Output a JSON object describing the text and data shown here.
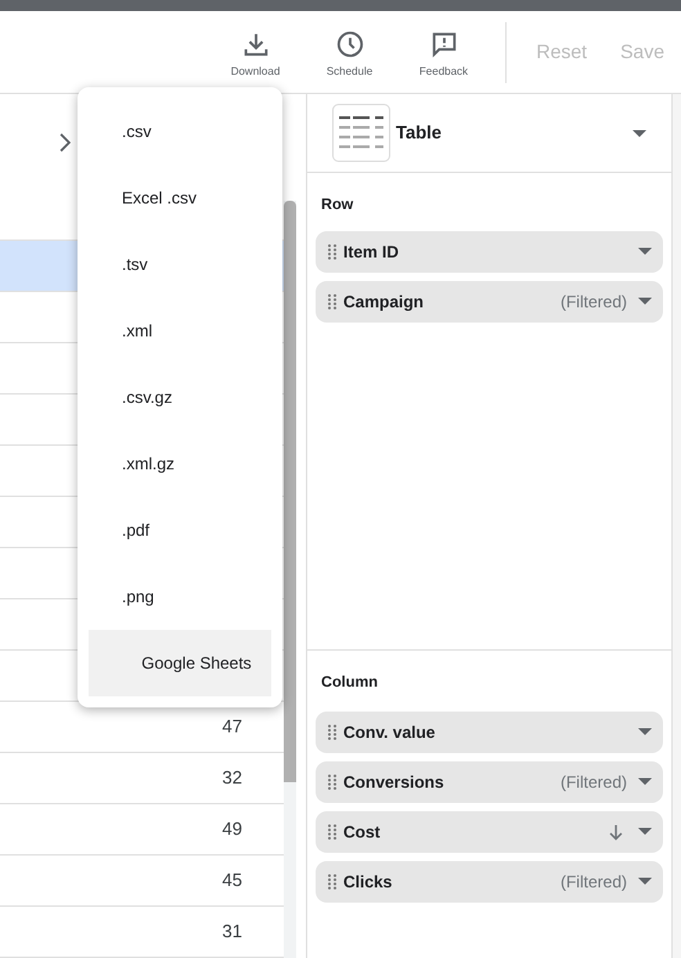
{
  "toolbar": {
    "actions": [
      {
        "kind": "download",
        "label": "Download"
      },
      {
        "kind": "schedule",
        "label": "Schedule"
      },
      {
        "kind": "feedback",
        "label": "Feedback"
      }
    ],
    "buttons": [
      {
        "label": "Reset",
        "disabled": true
      },
      {
        "label": "Save",
        "disabled": true
      }
    ]
  },
  "table": {
    "rows": [
      {
        "selected": false
      },
      {
        "selected": true
      },
      {
        "selected": false
      },
      {
        "selected": false
      },
      {
        "selected": false
      },
      {
        "selected": false
      },
      {
        "selected": false
      },
      {
        "selected": false
      },
      {
        "selected": false
      },
      {
        "selected": false
      },
      {
        "selected": false,
        "value": "47"
      },
      {
        "selected": false,
        "value": "32"
      },
      {
        "selected": false,
        "value": "49"
      },
      {
        "selected": false,
        "value": "45"
      },
      {
        "selected": false,
        "value": "31"
      }
    ]
  },
  "download_menu": {
    "items": [
      {
        "label": ".csv",
        "hovered": false
      },
      {
        "label": "Excel .csv",
        "hovered": false
      },
      {
        "label": ".tsv",
        "hovered": false
      },
      {
        "label": ".xml",
        "hovered": false
      },
      {
        "label": ".csv.gz",
        "hovered": false
      },
      {
        "label": ".xml.gz",
        "hovered": false
      },
      {
        "label": ".pdf",
        "hovered": false
      },
      {
        "label": ".png",
        "hovered": false
      },
      {
        "label": "Google Sheets",
        "hovered": true
      }
    ]
  },
  "chart_type": {
    "label": "Table"
  },
  "row_section": {
    "title": "Row",
    "fields": [
      {
        "label": "Item ID",
        "kind": "plain"
      },
      {
        "label": "Campaign",
        "kind": "filtered",
        "note": "(Filtered)"
      }
    ]
  },
  "column_section": {
    "title": "Column",
    "fields": [
      {
        "label": "Conv. value",
        "kind": "plain"
      },
      {
        "label": "Conversions",
        "kind": "filtered",
        "note": "(Filtered)"
      },
      {
        "label": "Cost",
        "kind": "sorted"
      },
      {
        "label": "Clicks",
        "kind": "filtered",
        "note": "(Filtered)"
      }
    ]
  }
}
